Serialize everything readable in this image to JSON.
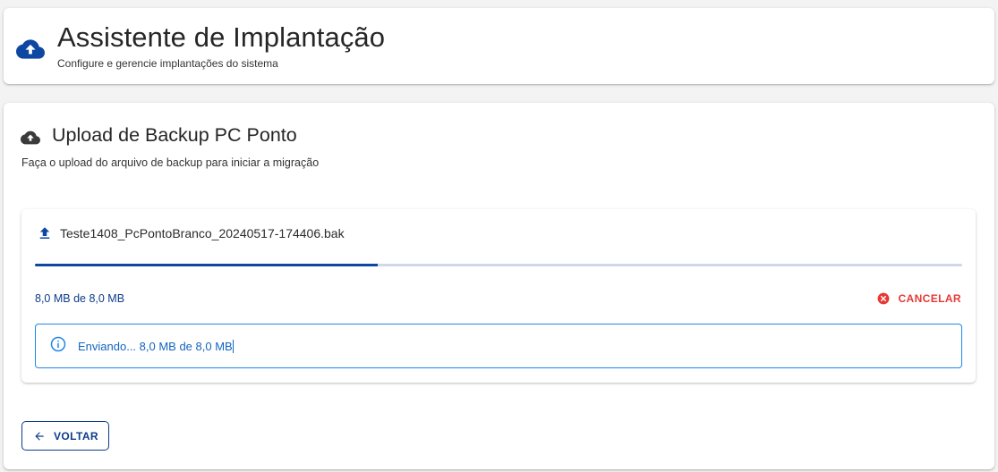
{
  "header": {
    "title": "Assistente de Implantação",
    "subtitle": "Configure e gerencie implantações do sistema",
    "icon": "cloud-upload-icon"
  },
  "section": {
    "title": "Upload de Backup PC Ponto",
    "description": "Faça o upload do arquivo de backup para iniciar a migração",
    "icon": "cloud-upload-icon"
  },
  "upload": {
    "file_name": "Teste1408_PcPontoBranco_20240517-174406.bak",
    "file_icon": "upload-icon",
    "progress_fraction": 0.37,
    "size_text": "8,0 MB de 8,0 MB",
    "cancel_label": "CANCELAR",
    "cancel_icon": "cancel-circle-icon",
    "info_text": "Enviando... 8,0 MB de 8,0 MB",
    "info_icon": "info-icon"
  },
  "footer": {
    "back_label": "VOLTAR",
    "back_icon": "arrow-left-icon"
  },
  "colors": {
    "primary": "#0d47a1",
    "danger": "#e53935",
    "info": "#1e88e5",
    "track": "#cfd8e8"
  }
}
